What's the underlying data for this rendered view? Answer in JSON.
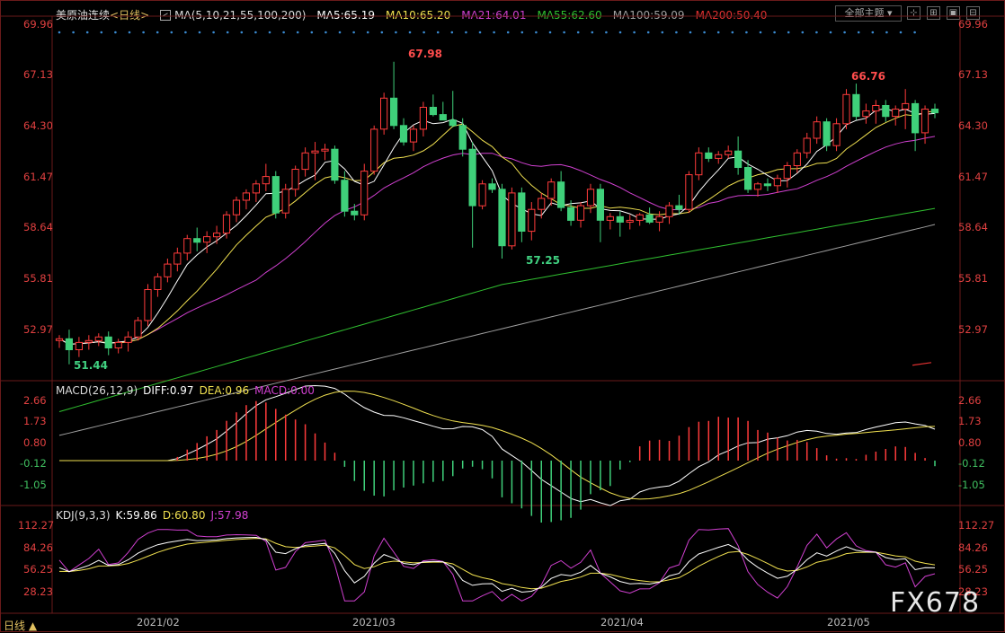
{
  "header": {
    "title": "美原油连续",
    "period": "<日线>",
    "ma_label": "MA(5,10,21,55,100,200)",
    "ma5": "MA5:65.19",
    "ma10": "MA10:65.20",
    "ma21": "MA21:64.01",
    "ma55": "MA55:62.60",
    "ma100": "MA100:59.09",
    "ma200": "MA200:50.40",
    "topic_button": "全部主题",
    "colors": {
      "ma5": "#ffffff",
      "ma10": "#f0e050",
      "ma21": "#d040d0",
      "ma55": "#30c030",
      "ma100": "#a0a0a0",
      "ma200": "#e03030"
    }
  },
  "main_axis": {
    "labels": [
      "69.96",
      "67.13",
      "64.30",
      "61.47",
      "58.64",
      "55.81",
      "52.97"
    ]
  },
  "annotations": {
    "high1": "67.98",
    "low1": "51.44",
    "low2": "57.25",
    "high2": "66.76"
  },
  "macd": {
    "title": "MACD(26,12,9)",
    "diff": "DIFF:0.97",
    "dea": "DEA:0.96",
    "macd": "MACD:0.00",
    "axis": [
      "2.66",
      "1.73",
      "0.80",
      "-0.12",
      "-1.05"
    ]
  },
  "kdj": {
    "title": "KDJ(9,3,3)",
    "k": "K:59.86",
    "d": "D:60.80",
    "j": "J:57.98",
    "axis": [
      "112.27",
      "84.26",
      "56.25",
      "28.23"
    ]
  },
  "x_axis": [
    "2021/02",
    "2021/03",
    "2021/04",
    "2021/05"
  ],
  "bottom_tab": "日线 ▲",
  "logo": "FX678",
  "chart_data": {
    "type": "candlestick",
    "title": "美原油连续",
    "ylim": [
      50.5,
      70.5
    ],
    "candles": [
      [
        52.7,
        53.0,
        52.3,
        52.8
      ],
      [
        52.8,
        53.3,
        51.4,
        52.2
      ],
      [
        52.2,
        52.9,
        51.8,
        52.6
      ],
      [
        52.6,
        53.0,
        52.2,
        52.7
      ],
      [
        52.7,
        53.1,
        52.4,
        52.9
      ],
      [
        52.9,
        53.2,
        51.9,
        52.3
      ],
      [
        52.3,
        52.8,
        52.0,
        52.6
      ],
      [
        52.6,
        53.2,
        52.1,
        52.9
      ],
      [
        52.9,
        54.0,
        52.7,
        53.8
      ],
      [
        53.8,
        55.8,
        53.5,
        55.5
      ],
      [
        55.5,
        56.4,
        55.1,
        56.2
      ],
      [
        56.2,
        57.2,
        55.9,
        56.9
      ],
      [
        56.9,
        57.8,
        56.5,
        57.5
      ],
      [
        57.5,
        58.5,
        57.1,
        58.3
      ],
      [
        58.3,
        58.9,
        57.6,
        58.1
      ],
      [
        58.1,
        58.7,
        57.5,
        58.4
      ],
      [
        58.4,
        59.0,
        58.0,
        58.6
      ],
      [
        58.6,
        59.8,
        58.3,
        59.6
      ],
      [
        59.6,
        60.6,
        59.2,
        60.4
      ],
      [
        60.4,
        61.0,
        59.9,
        60.8
      ],
      [
        60.8,
        61.5,
        60.3,
        61.3
      ],
      [
        61.3,
        62.4,
        60.9,
        61.7
      ],
      [
        61.7,
        62.0,
        59.4,
        59.7
      ],
      [
        59.7,
        61.3,
        59.4,
        61.0
      ],
      [
        61.0,
        62.3,
        60.6,
        62.1
      ],
      [
        62.1,
        63.3,
        61.7,
        63.0
      ],
      [
        63.0,
        63.6,
        61.5,
        63.1
      ],
      [
        63.1,
        63.5,
        62.6,
        63.2
      ],
      [
        63.2,
        63.4,
        61.3,
        61.5
      ],
      [
        61.5,
        62.0,
        59.5,
        59.8
      ],
      [
        59.8,
        60.2,
        59.3,
        59.6
      ],
      [
        59.6,
        62.4,
        59.3,
        62.0
      ],
      [
        62.0,
        64.5,
        61.8,
        64.3
      ],
      [
        64.3,
        66.3,
        64.0,
        66.0
      ],
      [
        66.0,
        68.0,
        64.3,
        64.5
      ],
      [
        64.5,
        64.9,
        63.4,
        63.6
      ],
      [
        63.6,
        64.5,
        63.1,
        64.3
      ],
      [
        64.3,
        65.8,
        63.9,
        65.5
      ],
      [
        65.5,
        66.2,
        65.0,
        65.1
      ],
      [
        65.1,
        65.8,
        64.8,
        64.8
      ],
      [
        64.8,
        66.4,
        64.4,
        64.5
      ],
      [
        64.5,
        64.9,
        62.8,
        63.2
      ],
      [
        63.2,
        63.6,
        57.8,
        60.1
      ],
      [
        60.1,
        61.5,
        59.9,
        61.3
      ],
      [
        61.3,
        61.6,
        60.8,
        61.0
      ],
      [
        61.0,
        61.3,
        57.2,
        57.9
      ],
      [
        57.9,
        61.1,
        57.7,
        60.8
      ],
      [
        60.8,
        61.1,
        58.1,
        58.7
      ],
      [
        58.7,
        60.3,
        58.2,
        59.9
      ],
      [
        59.9,
        60.8,
        59.4,
        60.5
      ],
      [
        60.5,
        61.6,
        60.1,
        61.4
      ],
      [
        61.4,
        62.0,
        59.8,
        60.0
      ],
      [
        60.0,
        60.4,
        59.0,
        59.3
      ],
      [
        59.3,
        60.3,
        58.9,
        60.1
      ],
      [
        60.1,
        61.3,
        59.7,
        61.0
      ],
      [
        61.0,
        61.3,
        58.1,
        59.3
      ],
      [
        59.3,
        59.7,
        58.8,
        59.5
      ],
      [
        59.5,
        59.8,
        58.4,
        59.2
      ],
      [
        59.2,
        59.6,
        58.8,
        59.3
      ],
      [
        59.3,
        59.7,
        59.0,
        59.6
      ],
      [
        59.6,
        60.0,
        59.1,
        59.2
      ],
      [
        59.2,
        59.8,
        58.7,
        59.5
      ],
      [
        59.5,
        60.3,
        59.1,
        60.1
      ],
      [
        60.1,
        60.7,
        59.6,
        59.9
      ],
      [
        59.9,
        62.0,
        59.7,
        61.8
      ],
      [
        61.8,
        63.3,
        61.5,
        63.0
      ],
      [
        63.0,
        63.3,
        62.5,
        62.7
      ],
      [
        62.7,
        63.1,
        62.4,
        62.9
      ],
      [
        62.9,
        63.4,
        62.7,
        63.1
      ],
      [
        63.1,
        63.9,
        61.8,
        62.2
      ],
      [
        62.2,
        62.6,
        60.8,
        61.0
      ],
      [
        61.0,
        61.4,
        60.6,
        61.3
      ],
      [
        61.3,
        61.6,
        60.9,
        61.2
      ],
      [
        61.2,
        61.8,
        60.8,
        61.6
      ],
      [
        61.6,
        62.5,
        61.1,
        62.3
      ],
      [
        62.3,
        63.2,
        61.9,
        63.0
      ],
      [
        63.0,
        64.1,
        62.7,
        63.8
      ],
      [
        63.8,
        65.0,
        63.5,
        64.7
      ],
      [
        64.7,
        64.9,
        63.1,
        63.4
      ],
      [
        63.4,
        64.9,
        63.1,
        64.6
      ],
      [
        64.6,
        66.5,
        64.3,
        66.2
      ],
      [
        66.2,
        66.8,
        64.8,
        65.0
      ],
      [
        65.0,
        65.7,
        64.6,
        65.3
      ],
      [
        65.3,
        65.9,
        64.6,
        65.6
      ],
      [
        65.6,
        65.9,
        64.7,
        65.0
      ],
      [
        65.0,
        65.6,
        64.5,
        65.4
      ],
      [
        65.4,
        66.5,
        64.3,
        65.7
      ],
      [
        65.7,
        65.9,
        63.1,
        64.1
      ],
      [
        64.1,
        65.6,
        63.5,
        65.4
      ],
      [
        65.4,
        65.7,
        64.9,
        65.2
      ]
    ]
  }
}
